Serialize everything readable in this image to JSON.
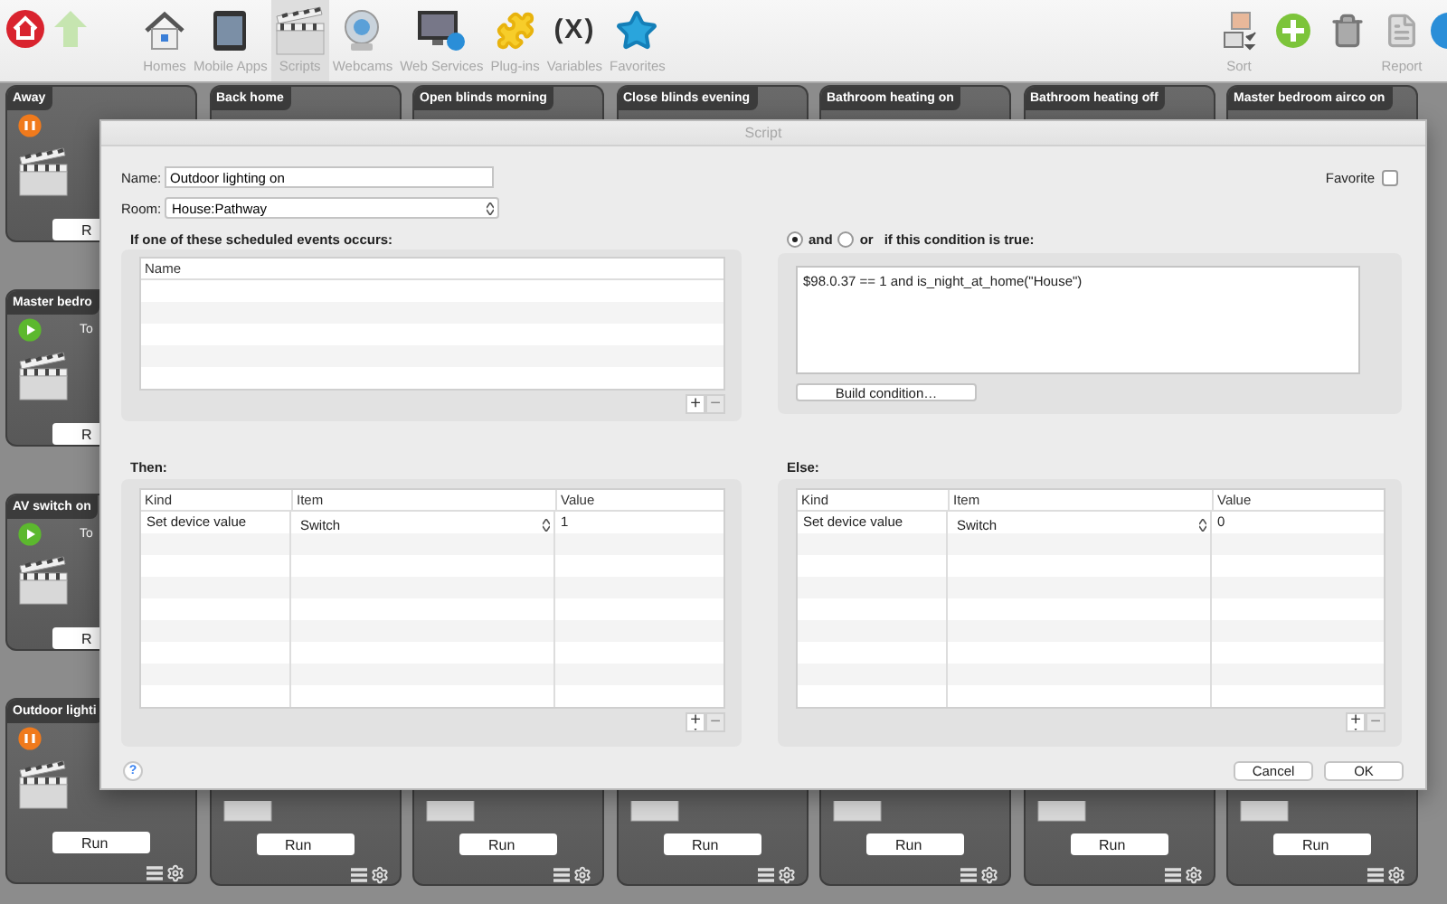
{
  "toolbar": {
    "nav": [
      {
        "kind": "home"
      },
      {
        "kind": "up"
      }
    ],
    "items": [
      {
        "label": "Homes",
        "selected": false
      },
      {
        "label": "Mobile Apps",
        "selected": false
      },
      {
        "label": "Scripts",
        "selected": true
      },
      {
        "label": "Webcams",
        "selected": false
      },
      {
        "label": "Web Services",
        "selected": false
      },
      {
        "label": "Plug-ins",
        "selected": false
      },
      {
        "label": "Variables",
        "glyph": "(X)",
        "selected": false
      },
      {
        "label": "Favorites",
        "selected": false
      }
    ],
    "right": [
      {
        "kind": "sort",
        "label": "Sort"
      },
      {
        "kind": "add"
      },
      {
        "kind": "trash"
      },
      {
        "kind": "report",
        "label": "Report"
      },
      {
        "kind": "help"
      }
    ]
  },
  "cards": [
    [
      {
        "kind": "left",
        "title": "Away",
        "paused": true,
        "run": "R"
      },
      {
        "kind": "title_only",
        "title": "Back home"
      },
      {
        "kind": "title_only",
        "title": "Open blinds morning"
      },
      {
        "kind": "title_only",
        "title": "Close blinds evening"
      },
      {
        "kind": "title_only",
        "title": "Bathroom heating on"
      },
      {
        "kind": "title_only",
        "title": "Bathroom heating off"
      },
      {
        "kind": "title_only",
        "title": "Master bedroom airco on"
      }
    ],
    [
      {
        "kind": "left",
        "title": "Master bedro",
        "paused": false,
        "caption": "To",
        "run": "R"
      }
    ],
    [
      {
        "kind": "left",
        "title": "AV switch on",
        "paused": false,
        "caption": "To",
        "run": "R"
      }
    ],
    [
      {
        "kind": "full",
        "title": "Outdoor lighti",
        "paused": true,
        "run": "Run"
      },
      {
        "kind": "bottom",
        "run": "Run"
      },
      {
        "kind": "bottom",
        "run": "Run"
      },
      {
        "kind": "bottom",
        "run": "Run"
      },
      {
        "kind": "bottom",
        "run": "Run"
      },
      {
        "kind": "bottom",
        "run": "Run"
      },
      {
        "kind": "bottom",
        "run": "Run"
      }
    ]
  ],
  "dialog": {
    "title": "Script",
    "name": {
      "label": "Name:",
      "value": "Outdoor lighting on"
    },
    "room": {
      "label": "Room:",
      "value": "House:Pathway"
    },
    "favorite": {
      "label": "Favorite",
      "checked": false
    },
    "events": {
      "heading": "If one of these scheduled events occurs:",
      "columns": [
        "Name"
      ],
      "add": "+",
      "remove": "−"
    },
    "condition": {
      "options": [
        {
          "label": "and",
          "selected": true
        },
        {
          "label": "or",
          "selected": false
        }
      ],
      "heading": "if this condition is true:",
      "value": "$98.0.37 == 1 and is_night_at_home(\"House\")",
      "button": "Build condition…"
    },
    "then": {
      "heading": "Then:",
      "columns": [
        "Kind",
        "Item",
        "Value"
      ],
      "rows": [
        {
          "action": "Set device value",
          "item": "Switch",
          "value": "1"
        }
      ],
      "add": "+",
      "remove": "−"
    },
    "else": {
      "heading": "Else:",
      "columns": [
        "Kind",
        "Item",
        "Value"
      ],
      "rows": [
        {
          "action": "Set device value",
          "item": "Switch",
          "value": "0"
        }
      ],
      "add": "+",
      "remove": "−"
    },
    "help": "?",
    "buttons": [
      {
        "label": "Cancel"
      },
      {
        "label": "OK"
      }
    ]
  }
}
